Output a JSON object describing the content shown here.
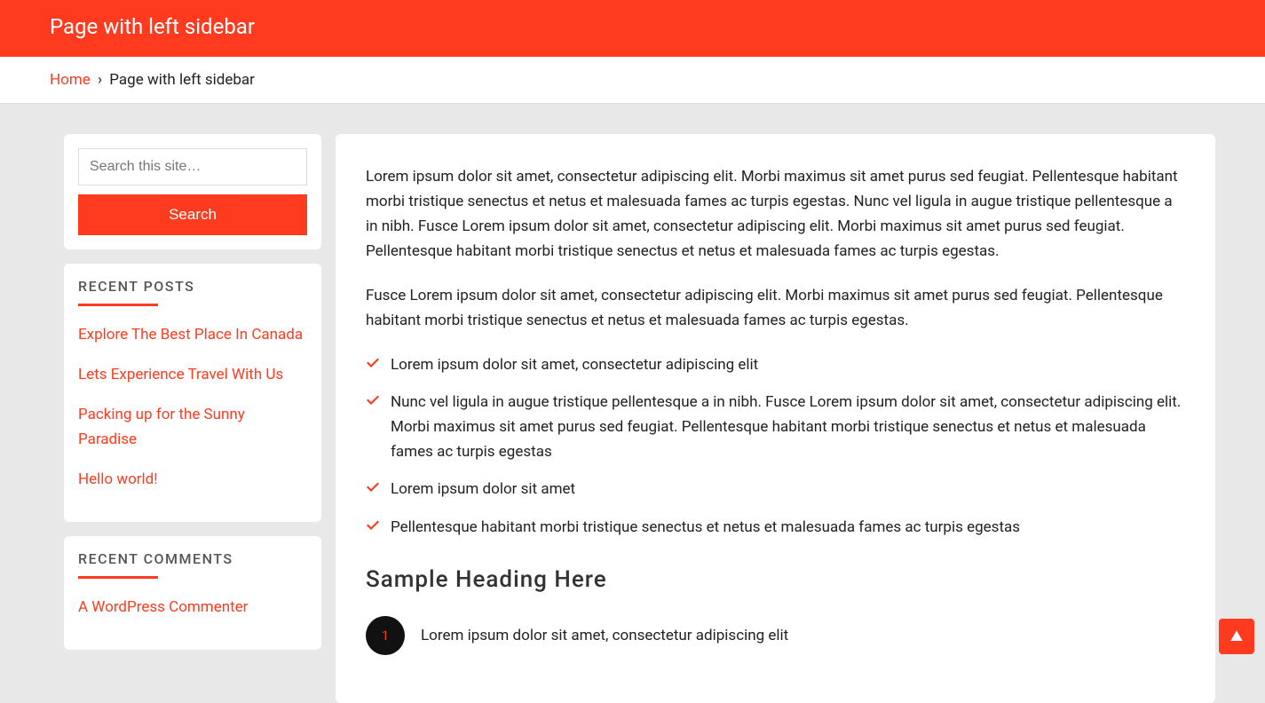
{
  "header": {
    "title": "Page with left sidebar"
  },
  "breadcrumb": {
    "home": "Home",
    "sep": "›",
    "current": "Page with left sidebar"
  },
  "sidebar": {
    "search": {
      "placeholder": "Search this site…",
      "button": "Search"
    },
    "recent_posts": {
      "title": "RECENT POSTS",
      "items": [
        "Explore The Best Place In Canada",
        "Lets Experience Travel With Us",
        "Packing up for the Sunny Paradise",
        "Hello world!"
      ]
    },
    "recent_comments": {
      "title": "RECENT COMMENTS",
      "items": [
        "A WordPress Commenter"
      ]
    }
  },
  "main": {
    "p1": "Lorem ipsum dolor sit amet, consectetur adipiscing elit. Morbi maximus sit amet purus sed feugiat. Pellentesque habitant morbi tristique senectus et netus et malesuada fames ac turpis egestas. Nunc vel ligula in augue tristique pellentesque a in nibh. Fusce Lorem ipsum dolor sit amet, consectetur adipiscing elit. Morbi maximus sit amet purus sed feugiat. Pellentesque habitant morbi tristique senectus et netus et malesuada fames ac turpis egestas.",
    "p2": "Fusce Lorem ipsum dolor sit amet, consectetur adipiscing elit. Morbi maximus sit amet purus sed feugiat. Pellentesque habitant morbi tristique senectus et netus et malesuada fames ac turpis egestas.",
    "checks": [
      "Lorem ipsum dolor sit amet, consectetur adipiscing elit",
      "Nunc vel ligula in augue tristique pellentesque a in nibh. Fusce Lorem ipsum dolor sit amet, consectetur adipiscing elit. Morbi maximus sit amet purus sed feugiat. Pellentesque habitant morbi tristique senectus et netus et malesuada fames ac turpis egestas",
      "Lorem ipsum dolor sit amet",
      "Pellentesque habitant morbi tristique senectus et netus et malesuada fames ac turpis egestas"
    ],
    "heading": "Sample Heading Here",
    "numbered": [
      {
        "n": "1",
        "text": "Lorem ipsum dolor sit amet, consectetur adipiscing elit"
      }
    ]
  }
}
